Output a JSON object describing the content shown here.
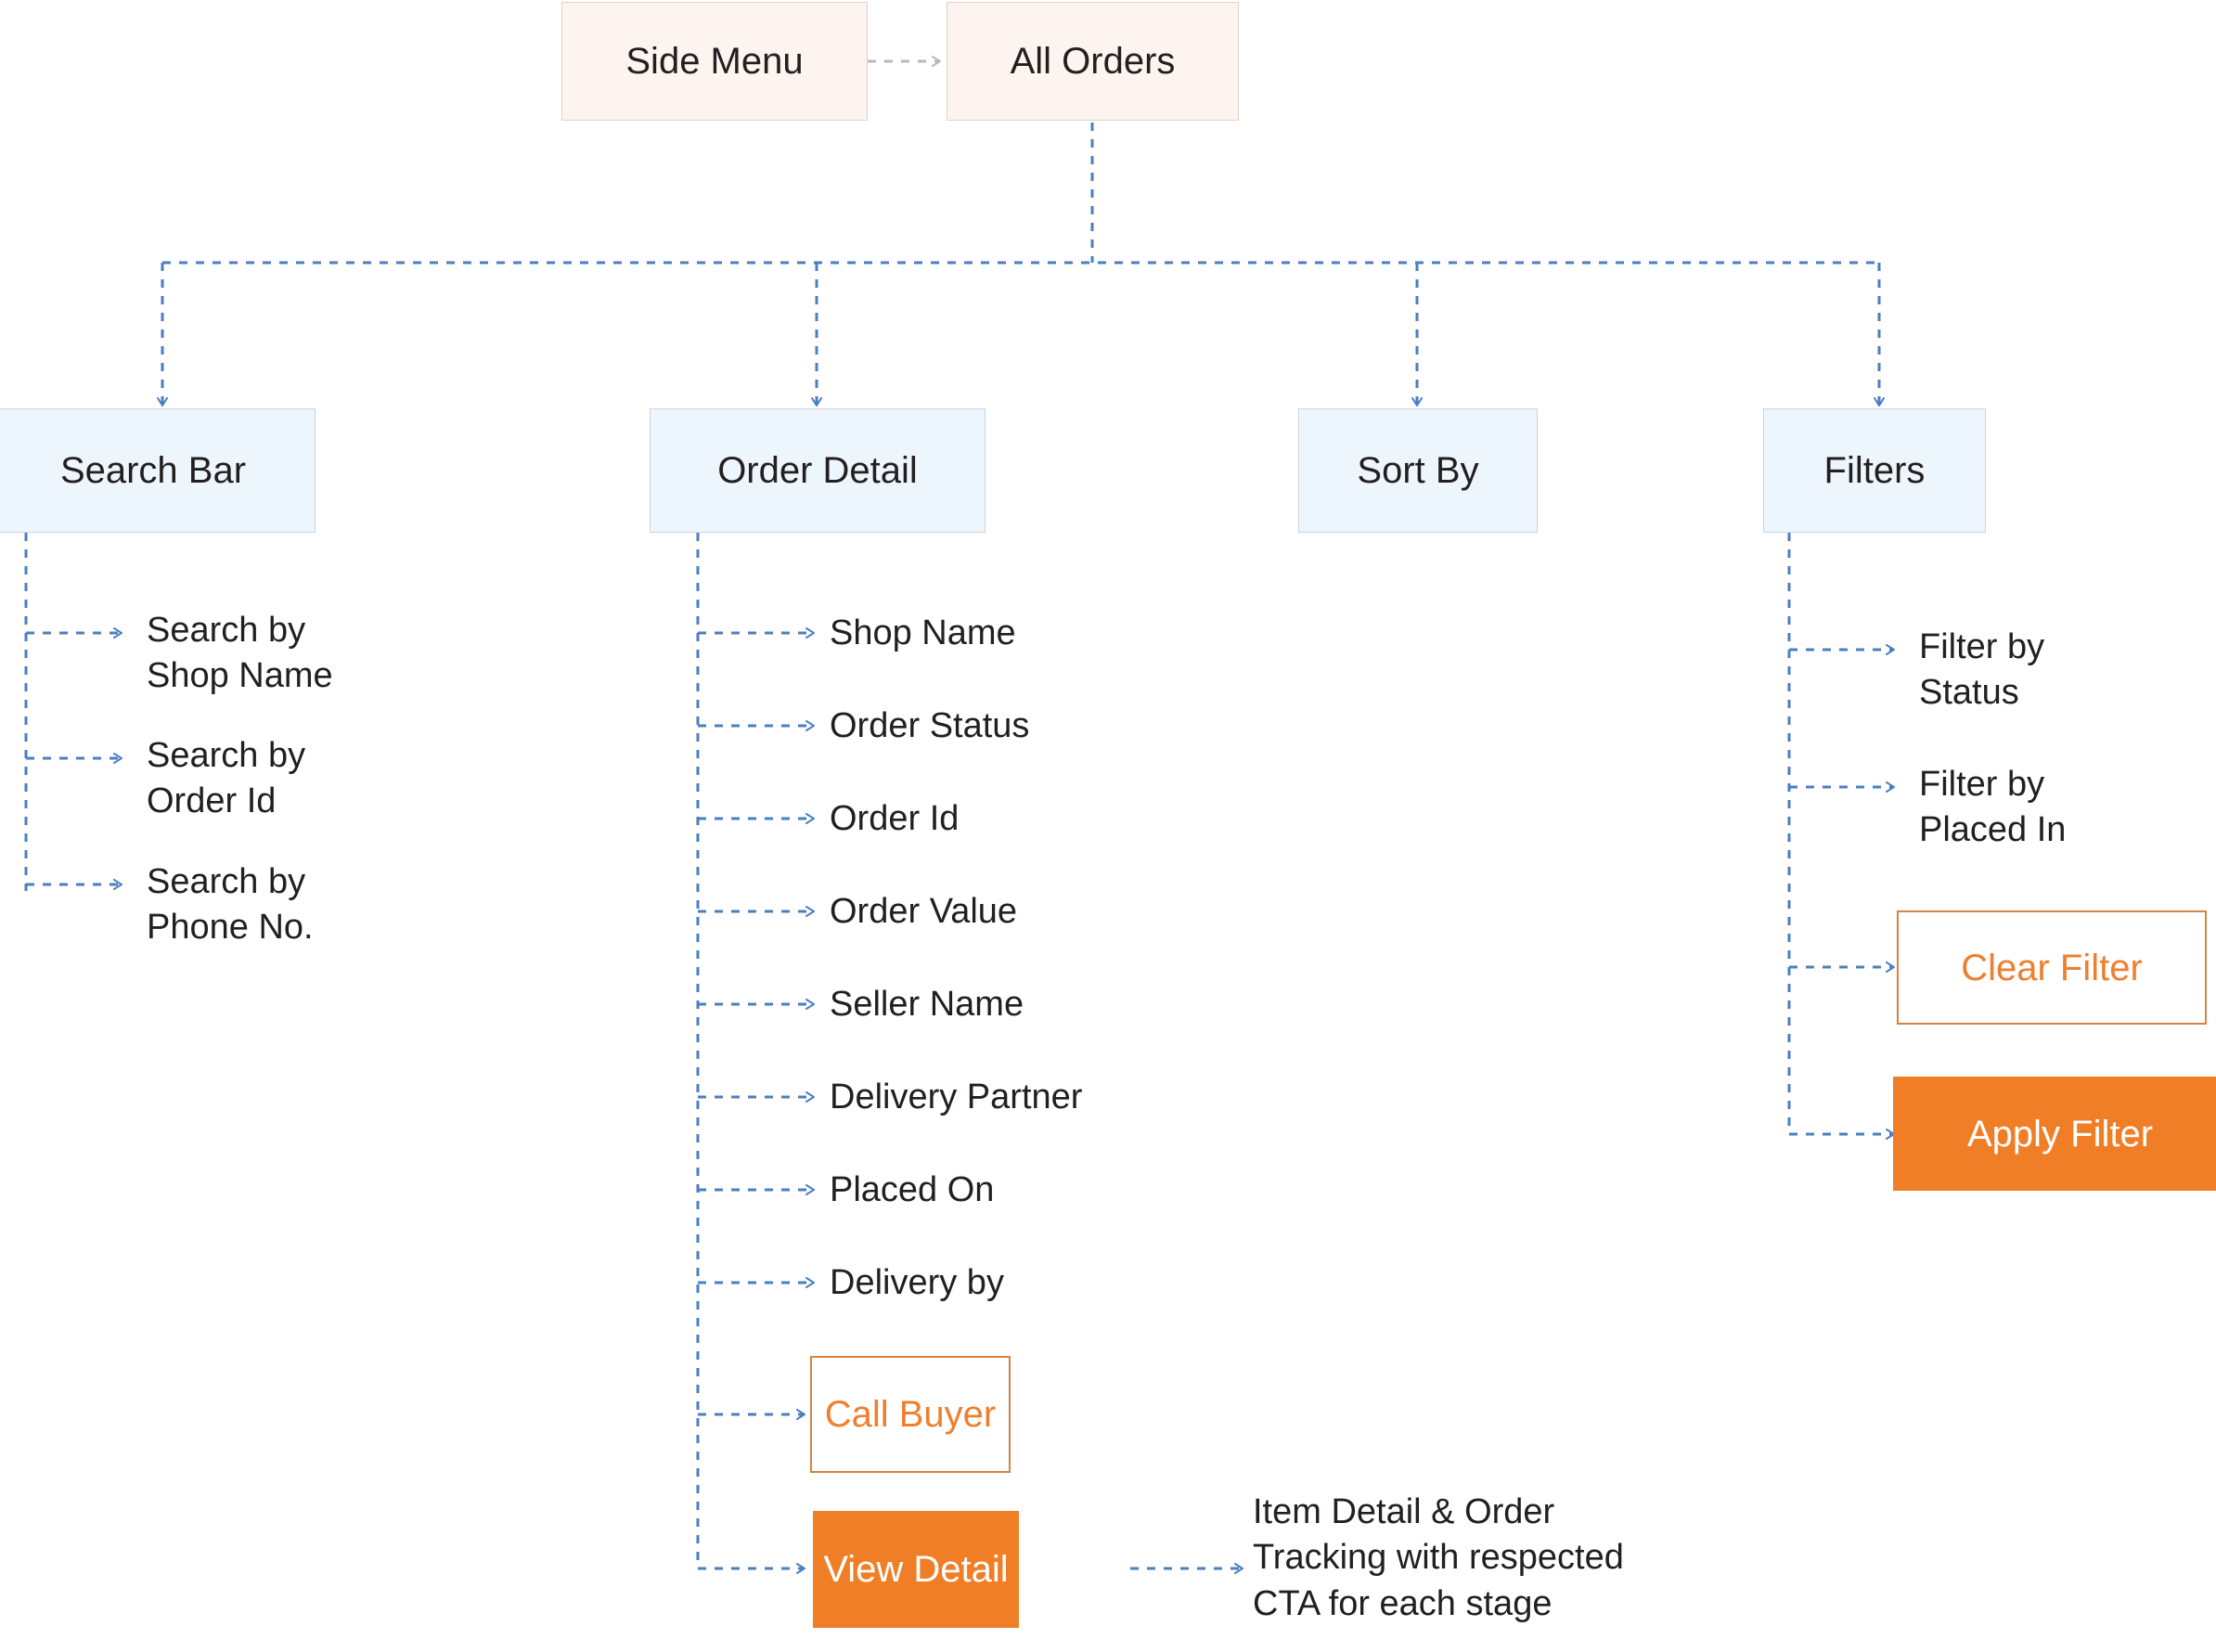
{
  "diagram": {
    "title": "All Orders screen flow",
    "colors": {
      "peach_fill": "#fdf3ef",
      "blue_fill": "#eef6fd",
      "box_border": "#cdd4db",
      "accent_orange": "#f07e26",
      "accent_orange_text": "#ef7f2e",
      "connector": "#4a7fc1",
      "background": "#ffffff"
    }
  },
  "root": {
    "side_menu": "Side Menu",
    "all_orders": "All Orders"
  },
  "sections": {
    "search_bar": {
      "label": "Search Bar",
      "children": [
        "Search by\nShop Name",
        "Search by\nOrder Id",
        "Search by\nPhone No."
      ]
    },
    "order_detail": {
      "label": "Order Detail",
      "children": [
        "Shop Name",
        "Order Status",
        "Order Id",
        "Order Value",
        "Seller Name",
        "Delivery Partner",
        "Placed On",
        "Delivery by"
      ],
      "buttons": {
        "call_buyer": "Call Buyer",
        "view_detail": "View Detail"
      },
      "view_detail_note": "Item Detail & Order\nTracking with respected\nCTA for each stage"
    },
    "sort_by": {
      "label": "Sort By",
      "children": []
    },
    "filters": {
      "label": "Filters",
      "children": [
        "Filter by\nStatus",
        "Filter by\nPlaced In"
      ],
      "buttons": {
        "clear_filter": "Clear Filter",
        "apply_filter": "Apply Filter"
      }
    }
  }
}
